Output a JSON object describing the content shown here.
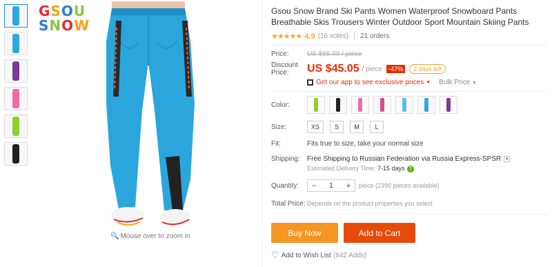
{
  "brand": {
    "logo_line1": [
      "G",
      "S",
      "O",
      "U"
    ],
    "logo_line2": [
      "S",
      "N",
      "O",
      "W"
    ],
    "logo_colors1": [
      "#e8292f",
      "#f9a11b",
      "#2a7bd6",
      "#8bc541"
    ],
    "logo_colors2": [
      "#2a7bd6",
      "#8bc541",
      "#e8292f",
      "#f9a11b"
    ]
  },
  "gallery": {
    "thumb_colors": [
      "#2da9dd",
      "#2da9dd",
      "#7a3b9a",
      "#f06aa8",
      "#8ed12b",
      "#222222"
    ],
    "zoom_hint": "Mouse over to zoom in"
  },
  "product": {
    "title": "Gsou Snow Brand Ski Pants Women Waterproof Snowboard Pants Breathable Skis Trousers Winter Outdoor Sport Mountain Skiing Pants",
    "stars": "★★★★★",
    "rating": "4.9",
    "votes": "(16 votes)",
    "orders": "21 orders"
  },
  "price": {
    "label": "Price:",
    "original": "US $85.00 / piece",
    "discount_label_1": "Discount",
    "discount_label_2": "Price:",
    "current": "US $45.05",
    "unit": "/ piece",
    "percent_off": "-47%",
    "days_left": "2 days left",
    "app_promo": "Get our app to see exclusive prices",
    "bulk": "Bulk Price"
  },
  "options": {
    "color_label": "Color:",
    "colors": [
      "#8ed12b",
      "#222222",
      "#f06aa8",
      "#e04a8c",
      "#5bbde8",
      "#2da9dd",
      "#7a3b9a"
    ],
    "size_label": "Size:",
    "sizes": [
      "XS",
      "S",
      "M",
      "L"
    ],
    "fit_label": "Fit:",
    "fit_value": "Fits true to size, take your normal size"
  },
  "shipping": {
    "label": "Shipping:",
    "main": "Free Shipping to Russian Federation via Russia Express-SPSR",
    "est_label": "Estimated Delivery Time:",
    "est_value": "7-15 days"
  },
  "quantity": {
    "label": "Quantity:",
    "minus": "−",
    "value": "1",
    "plus": "+",
    "available": "piece (2390 pieces available)"
  },
  "total": {
    "label": "Total Price:",
    "value": "Depends on the product properties you select"
  },
  "actions": {
    "buy_now": "Buy Now",
    "add_to_cart": "Add to Cart",
    "wishlist": "Add to Wish List",
    "wishlist_count": "(642 Adds)"
  }
}
